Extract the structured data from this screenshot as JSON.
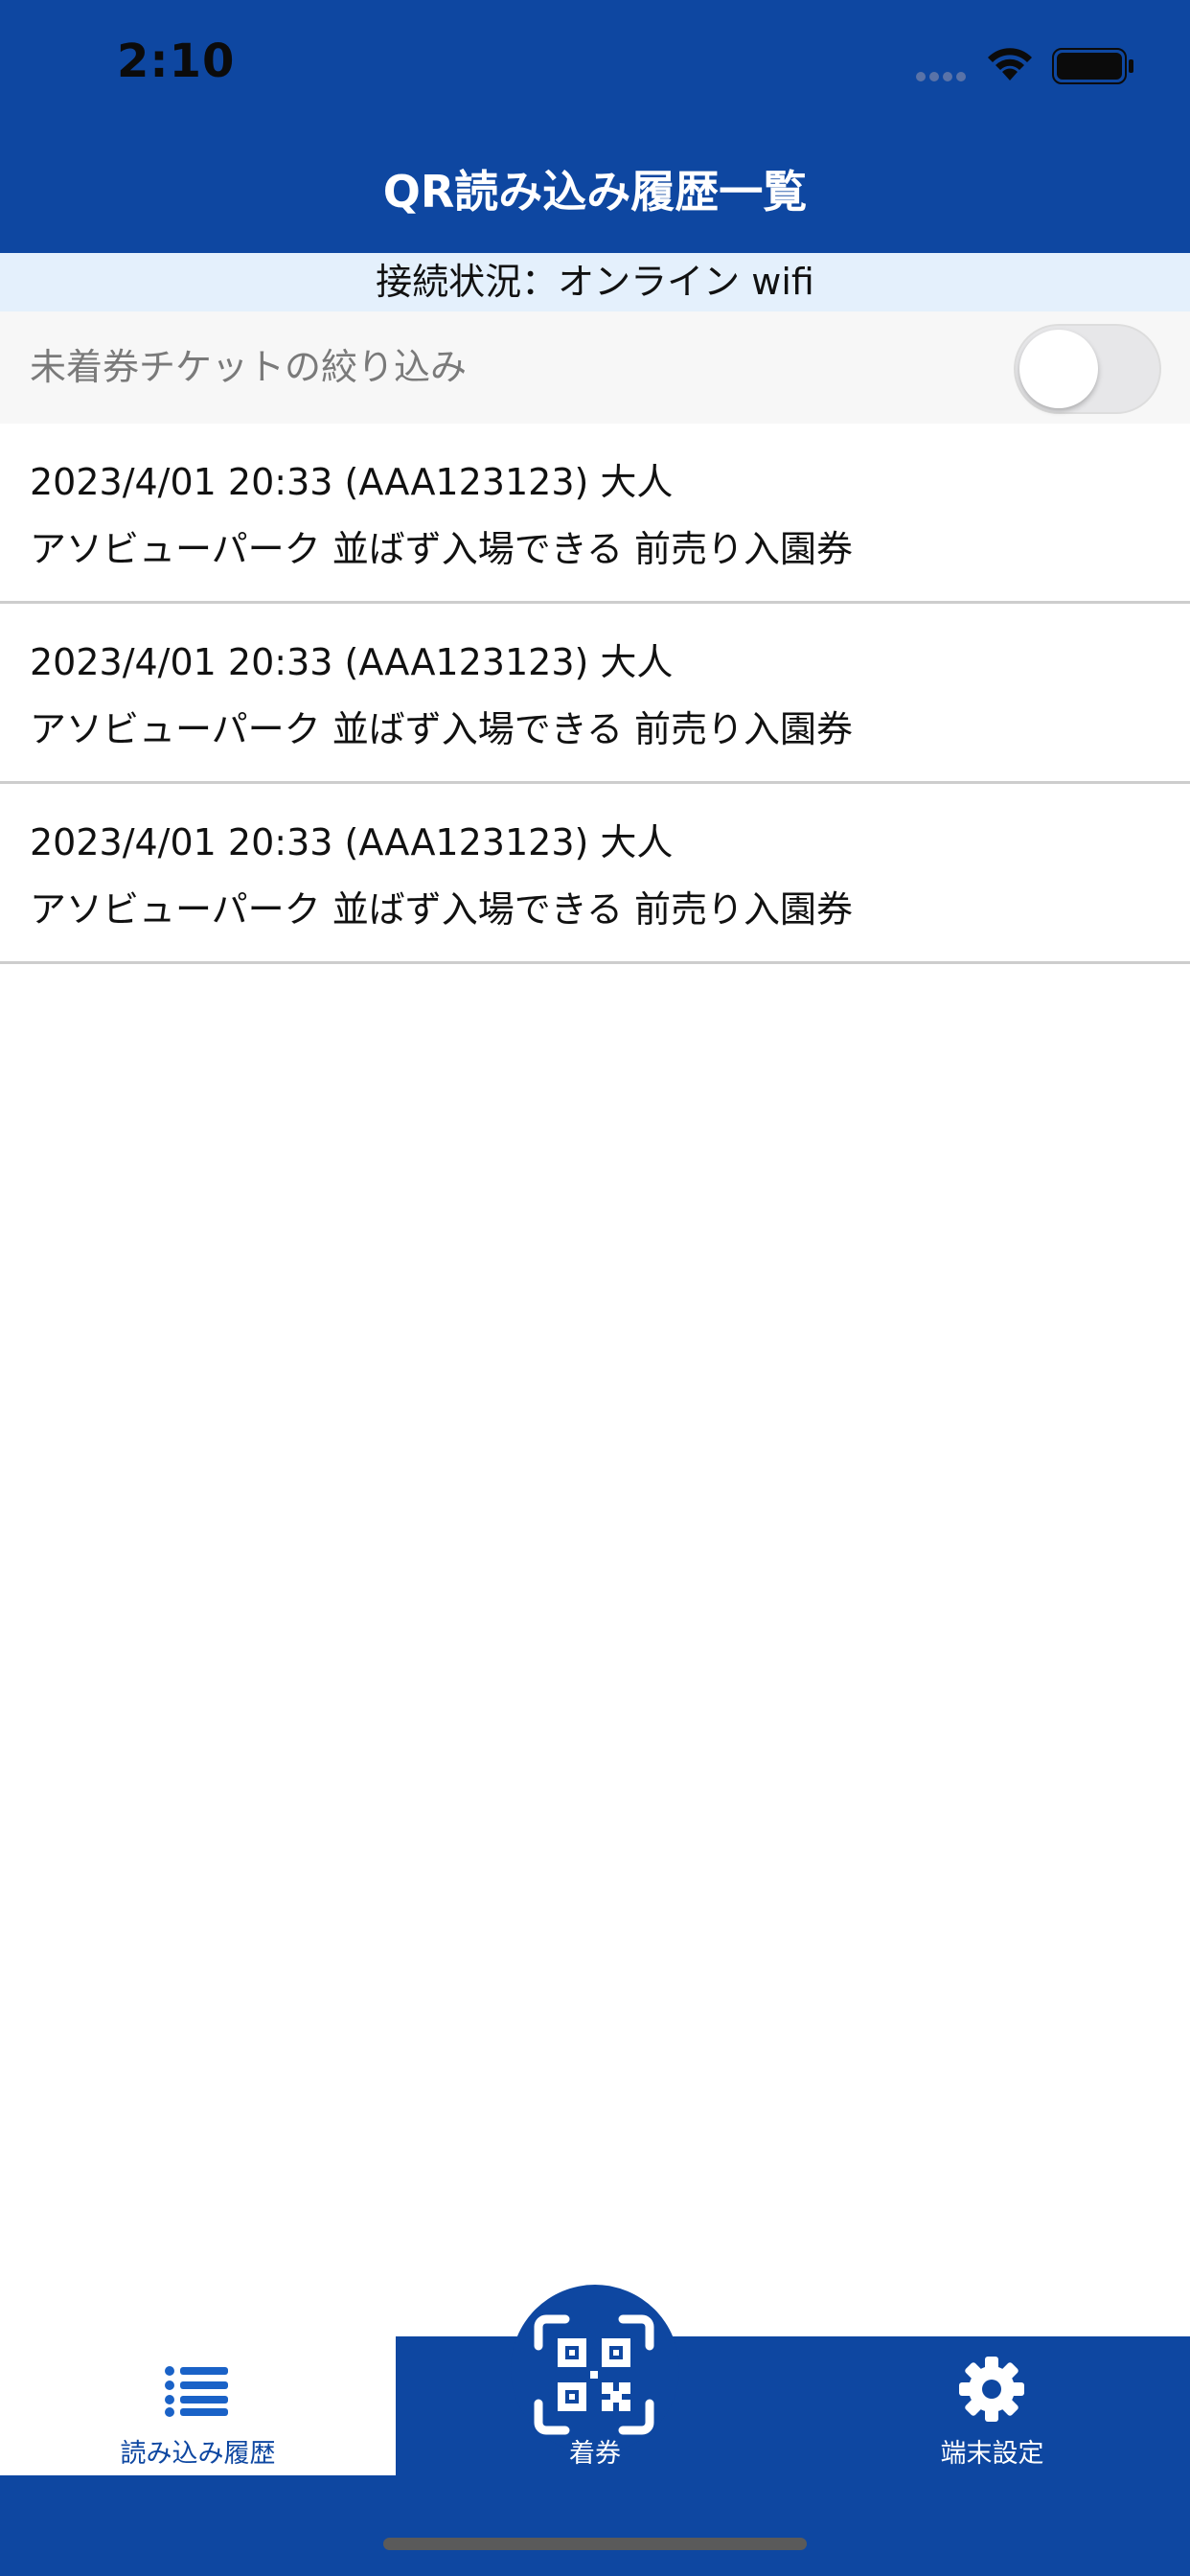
{
  "status_bar": {
    "time": "2:10"
  },
  "header": {
    "title": "QR読み込み履歴一覧"
  },
  "connection": {
    "status_text": "接続状況：オンライン wifi"
  },
  "filter": {
    "label": "未着券チケットの絞り込み",
    "enabled": false
  },
  "history": {
    "items": [
      {
        "line1": "2023/4/01 20:33 (AAA123123) 大人",
        "line2": "アソビューパーク 並ばず入場できる 前売り入園券"
      },
      {
        "line1": "2023/4/01 20:33 (AAA123123) 大人",
        "line2": "アソビューパーク 並ばず入場できる 前売り入園券"
      },
      {
        "line1": "2023/4/01 20:33 (AAA123123) 大人",
        "line2": "アソビューパーク 並ばず入場できる 前売り入園券"
      }
    ]
  },
  "tab_bar": {
    "tabs": [
      {
        "label": "読み込み履歴",
        "icon": "list-icon",
        "active": true
      },
      {
        "label": "着券",
        "icon": "qr-code-icon",
        "active": false
      },
      {
        "label": "端末設定",
        "icon": "gear-icon",
        "active": false
      }
    ]
  },
  "colors": {
    "primary": "#0e47a1",
    "banner_background": "#e4f0fc",
    "filter_background": "#f7f7f7",
    "divider": "#cdcdcd"
  }
}
